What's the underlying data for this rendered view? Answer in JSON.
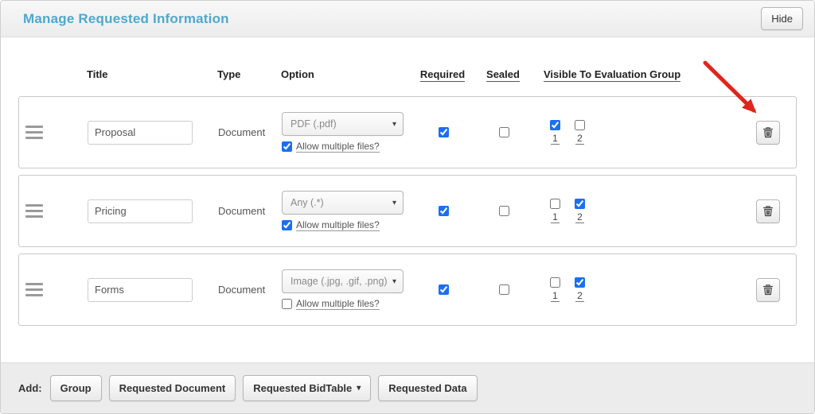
{
  "header": {
    "title": "Manage Requested Information",
    "hide_button": "Hide"
  },
  "columns": {
    "title": "Title",
    "type": "Type",
    "option": "Option",
    "required": "Required",
    "sealed": "Sealed",
    "visible": "Visible To Evaluation Group"
  },
  "rows": [
    {
      "title_value": "Proposal",
      "type": "Document",
      "option": "PDF (.pdf)",
      "allow_multiple_label": "Allow multiple files?",
      "allow_multiple": true,
      "required": true,
      "sealed": false,
      "group1_label": "1",
      "group2_label": "2",
      "group1": true,
      "group2": false
    },
    {
      "title_value": "Pricing",
      "type": "Document",
      "option": "Any (.*)",
      "allow_multiple_label": "Allow multiple files?",
      "allow_multiple": true,
      "required": true,
      "sealed": false,
      "group1_label": "1",
      "group2_label": "2",
      "group1": false,
      "group2": true
    },
    {
      "title_value": "Forms",
      "type": "Document",
      "option": "Image (.jpg, .gif, .png)",
      "allow_multiple_label": "Allow multiple files?",
      "allow_multiple": false,
      "required": true,
      "sealed": false,
      "group1_label": "1",
      "group2_label": "2",
      "group1": false,
      "group2": true
    }
  ],
  "footer": {
    "add_label": "Add:",
    "buttons": [
      "Group",
      "Requested Document",
      "Requested BidTable",
      "Requested Data"
    ]
  },
  "icons": {
    "caret_down": "▾"
  },
  "colors": {
    "title_accent": "#4fa8cc",
    "checkbox_checked": "#1b6ff0",
    "arrow_red": "#e0251c"
  }
}
